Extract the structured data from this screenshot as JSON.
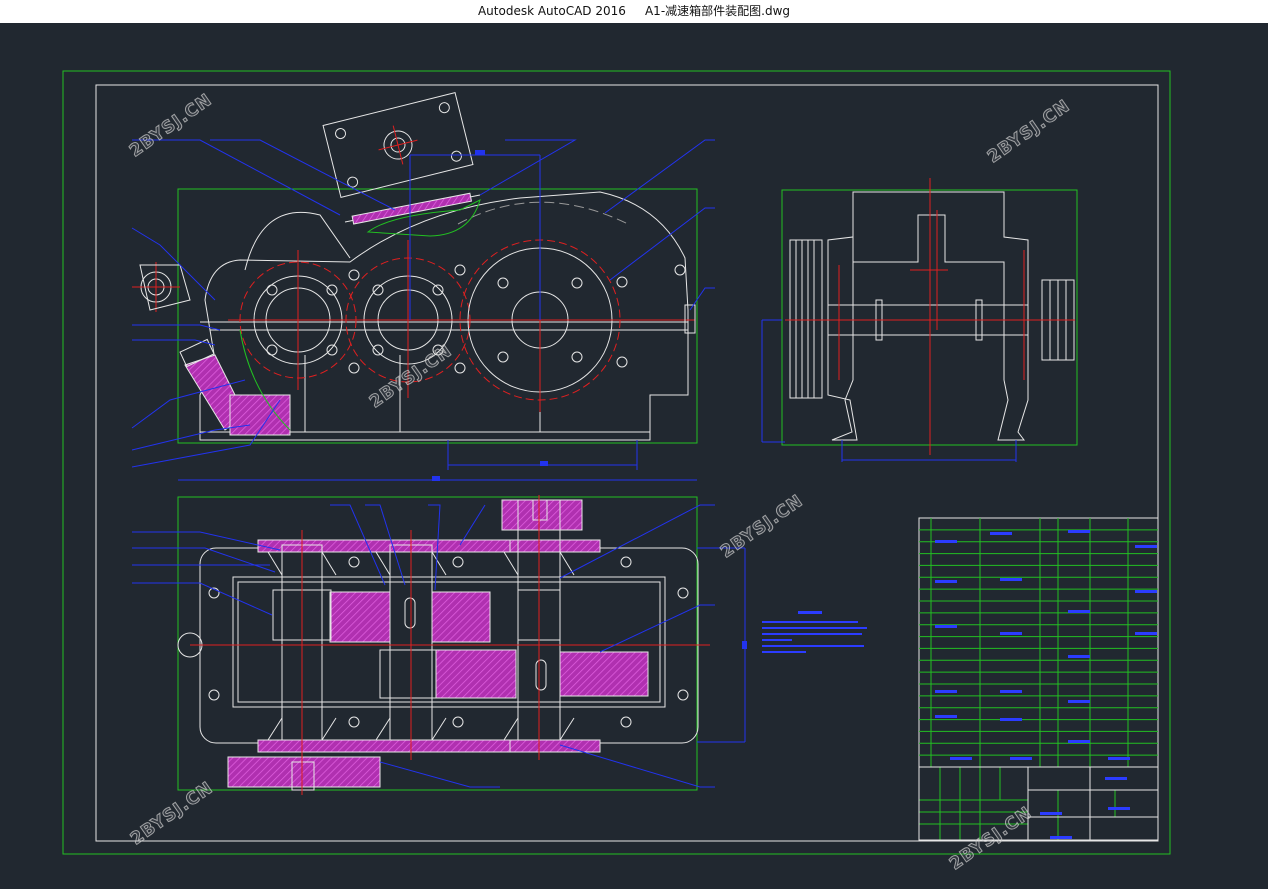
{
  "titlebar": {
    "app": "Autodesk AutoCAD 2016",
    "file": "A1-减速箱部件装配图.dwg"
  },
  "watermark": "2BYSJ.CN",
  "colors": {
    "background": "#212830",
    "border_green": "#22c022",
    "line_white": "#e6e6e6",
    "dimension_blue": "#2233ee",
    "center_red": "#e02020",
    "section_magenta": "#b030b0"
  }
}
